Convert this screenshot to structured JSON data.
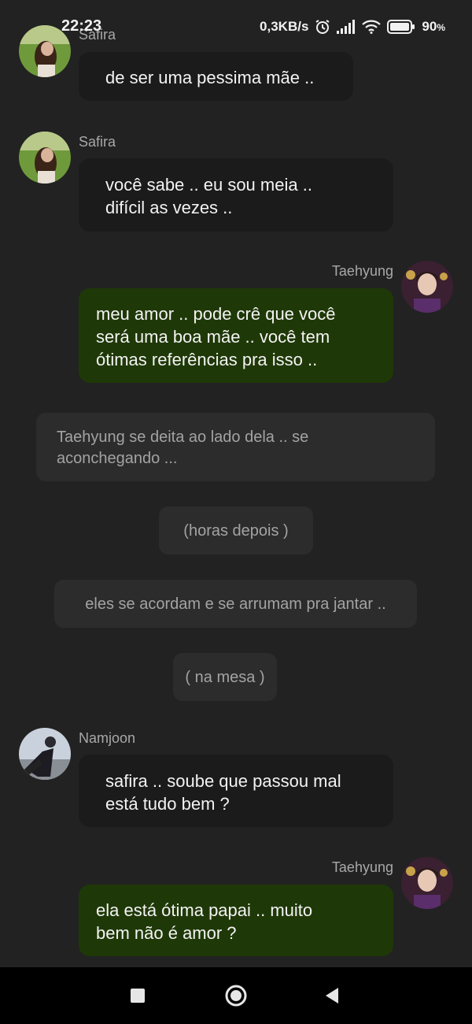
{
  "status_bar": {
    "time": "22:23",
    "network_speed": "0,3KB/s",
    "battery": "90",
    "battery_unit": "%",
    "icons": [
      "alarm-icon",
      "signal-icon",
      "wifi-icon",
      "battery-icon"
    ]
  },
  "messages": [
    {
      "sender": "Safira",
      "side": "left",
      "text": "de ser uma pessima mãe .."
    },
    {
      "sender": "Safira",
      "side": "left",
      "text": "você sabe .. eu sou meia ..\ndifícil as vezes .."
    },
    {
      "sender": "Taehyung",
      "side": "right",
      "text": "meu amor .. pode crê que você\nserá uma boa mãe .. você tem\nótimas referências pra isso .."
    },
    {
      "narration": "Taehyung se deita ao lado dela .. se\naconchegando ..."
    },
    {
      "narration": "(horas depois )"
    },
    {
      "narration": "eles se acordam e se arrumam pra jantar .."
    },
    {
      "narration": "( na mesa )"
    },
    {
      "sender": "Namjoon",
      "side": "left",
      "text": "safira .. soube que passou mal\nestá tudo bem ?"
    },
    {
      "sender": "Taehyung",
      "side": "right",
      "text": "ela está ótima papai .. muito\nbem não é amor ?"
    }
  ],
  "colors": {
    "background": "#222222",
    "bubble_left": "#1b1b1b",
    "bubble_right": "#1f3807",
    "narration": "#2c2c2c"
  },
  "nav_bar": {
    "icons": [
      "recent-apps-icon",
      "home-icon",
      "back-icon"
    ]
  }
}
